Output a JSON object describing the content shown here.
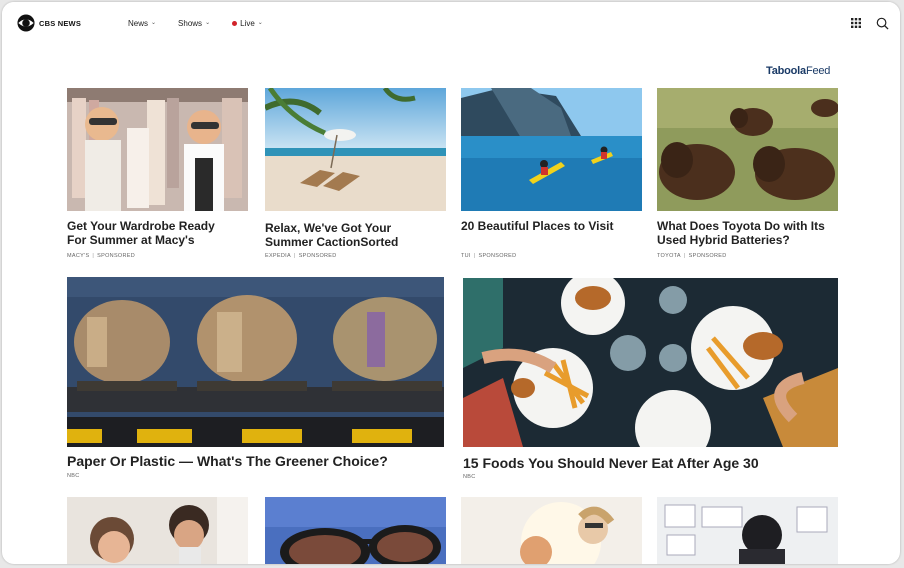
{
  "header": {
    "logo_text": "CBS NEWS",
    "nav": [
      {
        "label": "News"
      },
      {
        "label": "Shows"
      },
      {
        "label": "Live"
      }
    ]
  },
  "feed": {
    "brand_part1": "Taboola",
    "brand_part2": "Feed"
  },
  "cards": [
    {
      "title": "Get Your Wardrobe Ready For Summer at Macy's",
      "source": "MACY'S",
      "tag": "SPONSORED"
    },
    {
      "title": "Relax, We've Got Your Summer CactionSorted",
      "source": "EXPEDIA",
      "tag": "SPONSORED"
    },
    {
      "title": "20 Beautiful Places to Visit",
      "source": "TUI",
      "tag": "SPONSORED"
    },
    {
      "title": "What Does Toyota Do with Its Used Hybrid Batteries?",
      "source": "TOYOTA",
      "tag": "SPONSORED"
    },
    {
      "title": "Paper Or Plastic — What's The Greener Choice?",
      "source": "NBC"
    },
    {
      "title": "15 Foods You Should Never Eat After Age 30",
      "source": "NBC"
    }
  ],
  "colors": {
    "live_dot": "#d1232a",
    "brand": "#1a3a66"
  },
  "icons": [
    "cbs-eye-icon",
    "chevron-down-icon",
    "live-dot-icon",
    "apps-grid-icon",
    "search-icon"
  ]
}
